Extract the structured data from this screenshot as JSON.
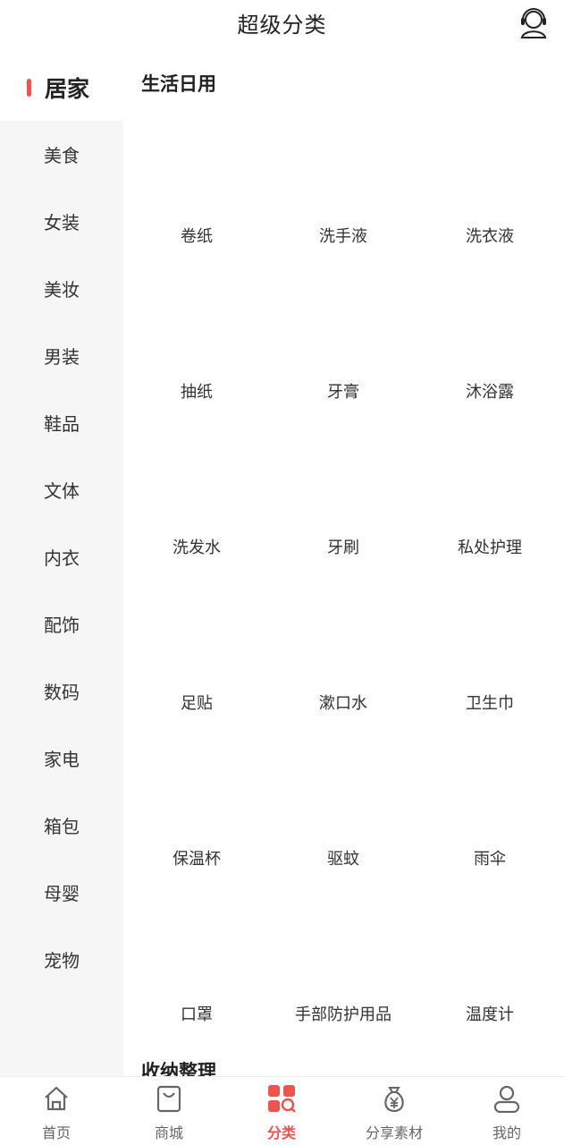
{
  "header": {
    "title": "超级分类"
  },
  "sidebar": {
    "items": [
      {
        "label": "居家",
        "active": true
      },
      {
        "label": "美食"
      },
      {
        "label": "女装"
      },
      {
        "label": "美妆"
      },
      {
        "label": "男装"
      },
      {
        "label": "鞋品"
      },
      {
        "label": "文体"
      },
      {
        "label": "内衣"
      },
      {
        "label": "配饰"
      },
      {
        "label": "数码"
      },
      {
        "label": "家电"
      },
      {
        "label": "箱包"
      },
      {
        "label": "母婴"
      },
      {
        "label": "宠物"
      }
    ]
  },
  "content": {
    "sections": [
      {
        "title": "生活日用",
        "items": [
          "卷纸",
          "洗手液",
          "洗衣液",
          "抽纸",
          "牙膏",
          "沐浴露",
          "洗发水",
          "牙刷",
          "私处护理",
          "足贴",
          "漱口水",
          "卫生巾",
          "保温杯",
          "驱蚊",
          "雨伞",
          "口罩",
          "手部防护用品",
          "温度计"
        ]
      },
      {
        "title": "收纳整理",
        "items": []
      }
    ]
  },
  "tabbar": {
    "items": [
      {
        "label": "首页",
        "icon": "home-icon"
      },
      {
        "label": "商城",
        "icon": "shopping-bag-icon"
      },
      {
        "label": "分类",
        "icon": "category-grid-icon",
        "active": true
      },
      {
        "label": "分享素材",
        "icon": "money-bag-icon"
      },
      {
        "label": "我的",
        "icon": "user-icon"
      }
    ]
  },
  "colors": {
    "accent": "#f0534e",
    "sidebar_bg": "#f6f6f6",
    "text": "#333333"
  }
}
